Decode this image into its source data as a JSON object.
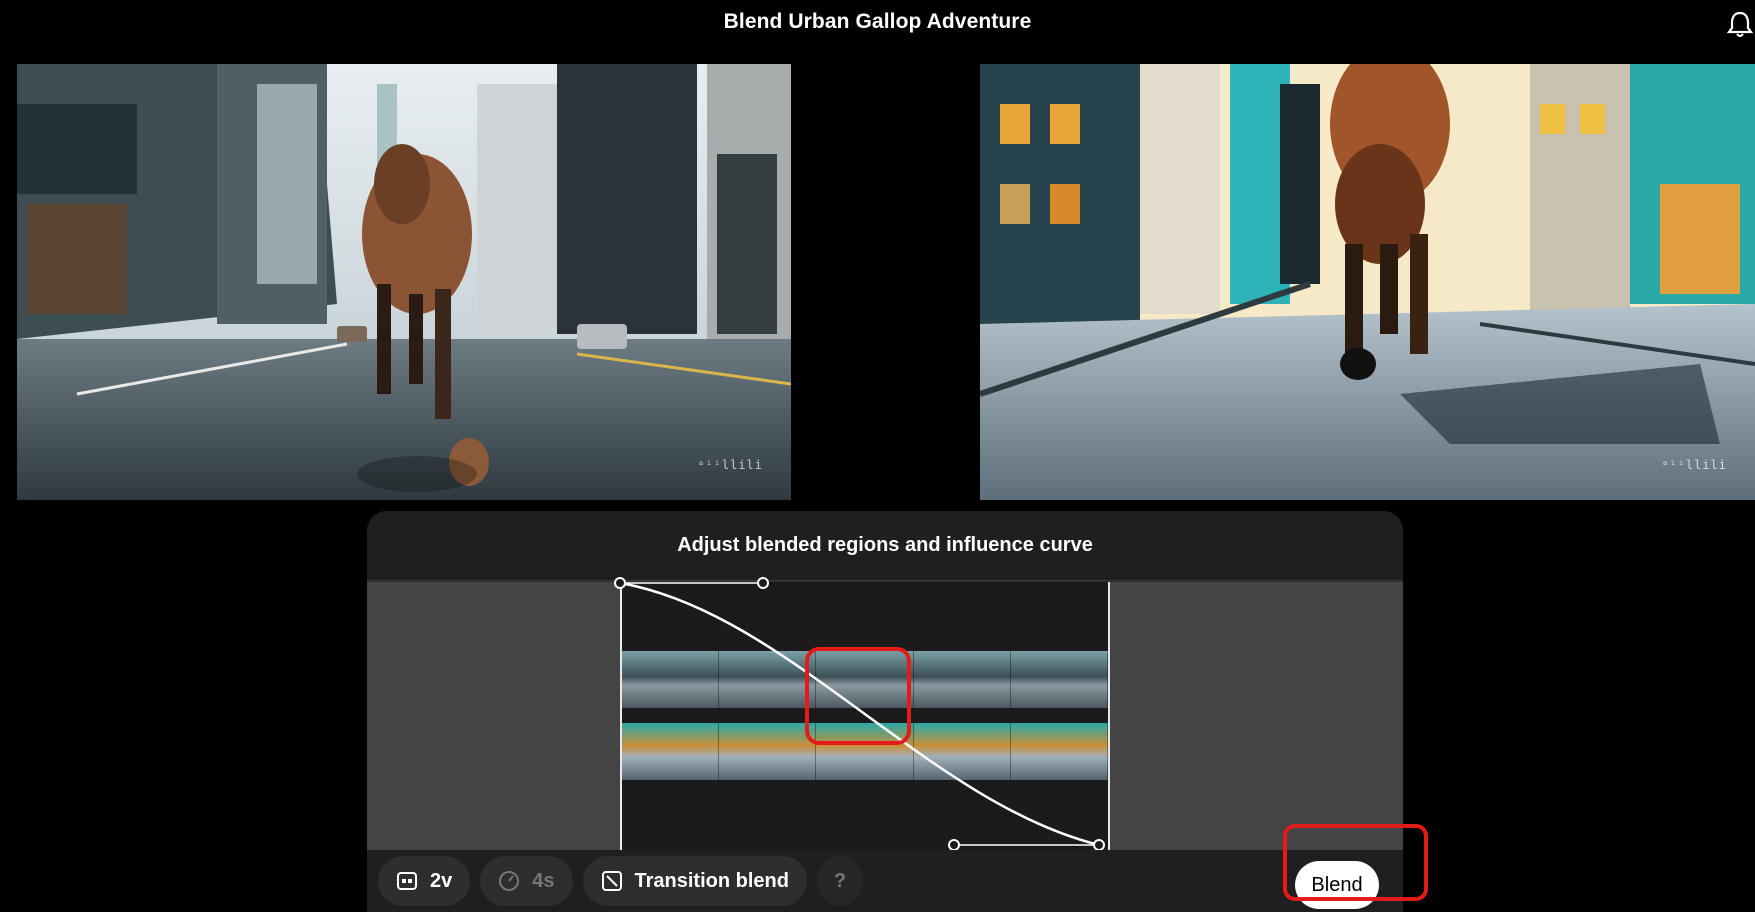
{
  "header": {
    "title": "Blend Urban Gallop Adventure",
    "notification_icon": "bell-icon"
  },
  "videos": {
    "left": {
      "watermark": "ᵃⁱⁱllili"
    },
    "right": {
      "watermark": "ᵃⁱⁱllili"
    }
  },
  "panel": {
    "title": "Adjust blended regions and influence curve",
    "timeline": {
      "top_strip_frames": 5,
      "bottom_strip_frames": 5
    }
  },
  "toolbar": {
    "video_count_label": "2v",
    "duration_label": "4s",
    "mode_label": "Transition blend",
    "help_label": "?",
    "blend_button_label": "Blend"
  },
  "colors": {
    "highlight": "#e31b1b",
    "background": "#000000",
    "panel": "#2b2b2b"
  }
}
